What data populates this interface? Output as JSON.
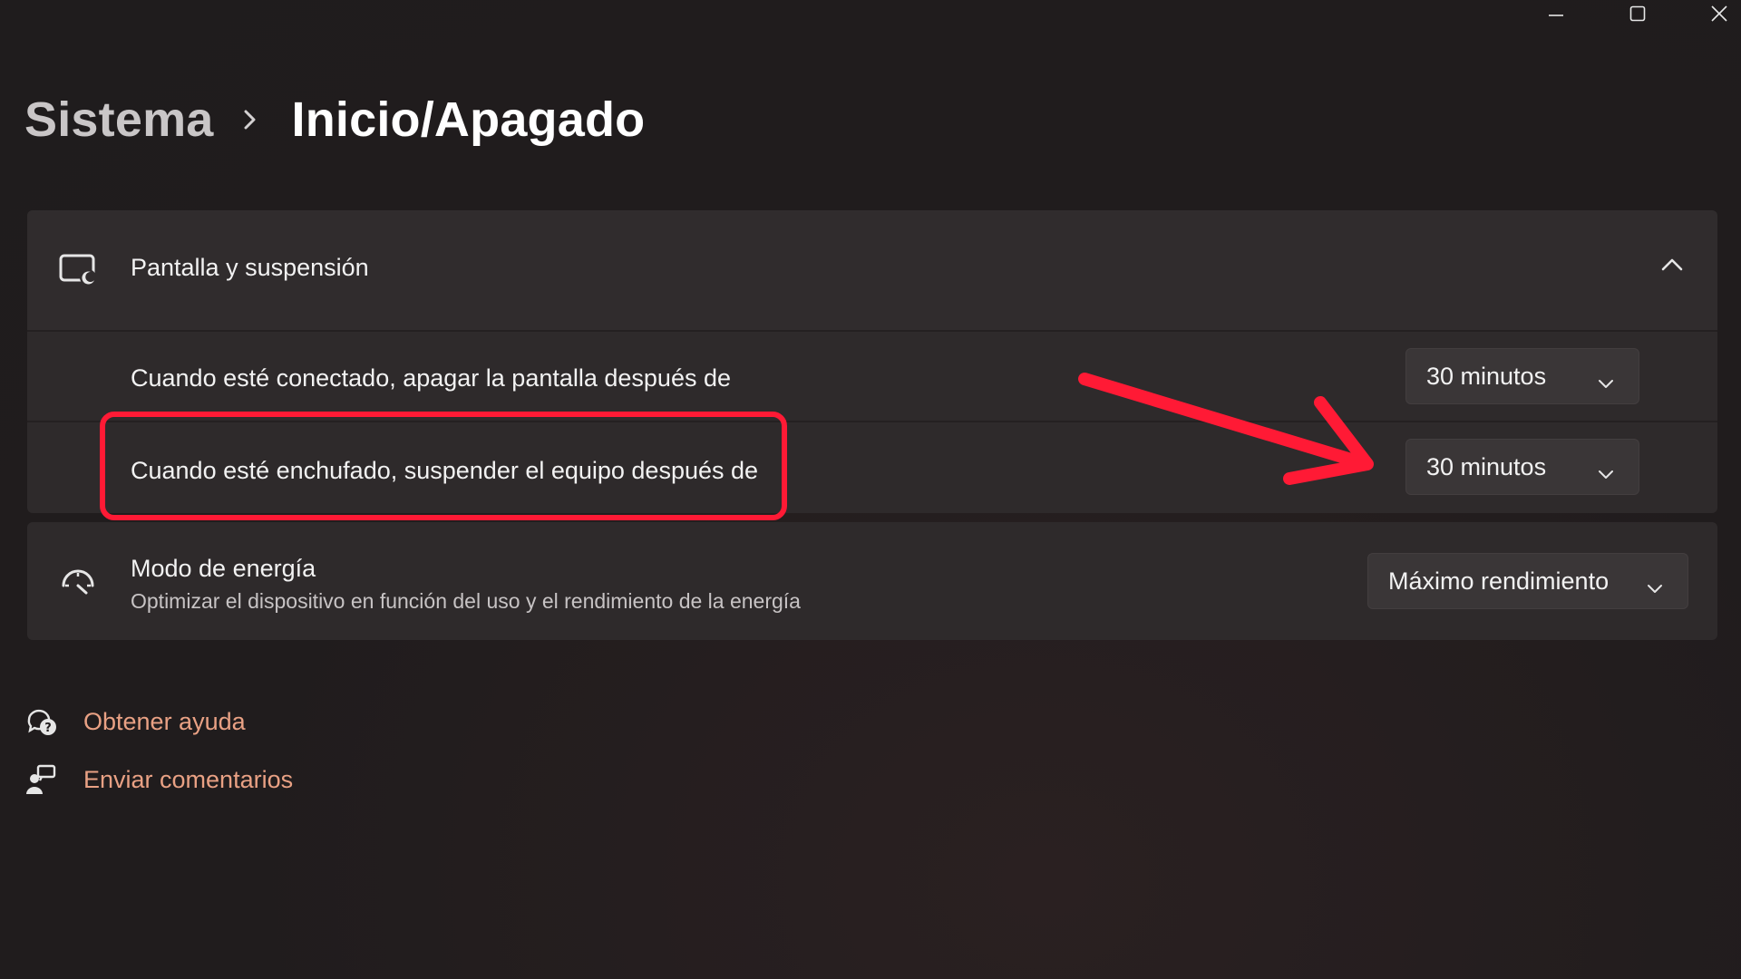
{
  "window": {
    "minimize_icon": "minimize-icon",
    "maximize_icon": "maximize-icon",
    "close_icon": "close-icon"
  },
  "breadcrumb": {
    "parent": "Sistema",
    "separator_icon": "chevron-right-icon",
    "current": "Inicio/Apagado"
  },
  "display_sleep": {
    "title": "Pantalla y suspensión",
    "icon": "display-sleep-icon",
    "expanded": true,
    "rows": [
      {
        "label": "Cuando esté conectado, apagar la pantalla después de",
        "value": "30 minutos"
      },
      {
        "label": "Cuando esté enchufado, suspender el equipo después de",
        "value": "30 minutos"
      }
    ]
  },
  "power_mode": {
    "title": "Modo de energía",
    "description": "Optimizar el dispositivo en función del uso y el rendimiento de la energía",
    "value": "Máximo rendimiento",
    "icon": "power-mode-gauge-icon"
  },
  "links": {
    "help": "Obtener ayuda",
    "feedback": "Enviar comentarios"
  },
  "colors": {
    "accent_link": "#e9a184",
    "annotation_red": "#ff1a35",
    "background": "#201c1d",
    "card": "#2e2a2b"
  }
}
